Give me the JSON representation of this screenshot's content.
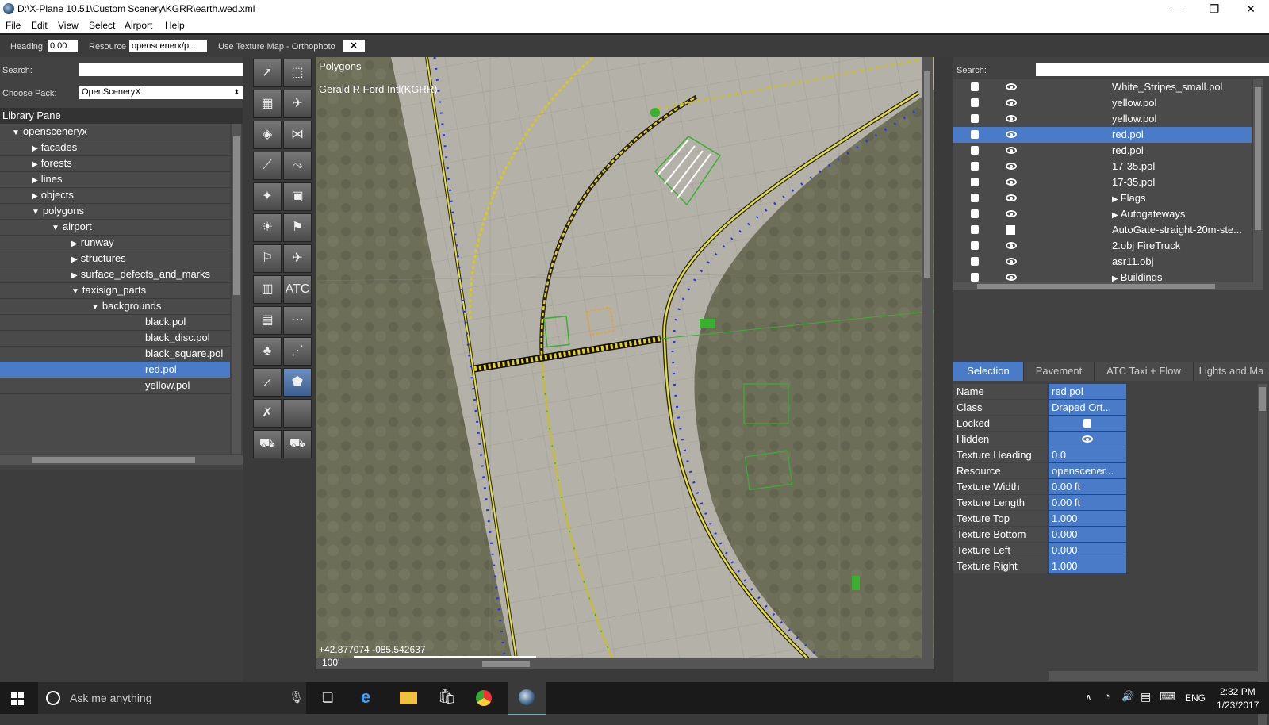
{
  "window": {
    "title": "D:\\X-Plane 10.51\\Custom Scenery\\KGRR\\earth.wed.xml",
    "minimize": "—",
    "maximize": "❐",
    "close": "✕"
  },
  "menu": [
    "File",
    "Edit",
    "View",
    "Select",
    "Airport",
    "Help"
  ],
  "toolbar": {
    "heading_label": "Heading",
    "heading_value": "0.00",
    "resource_label": "Resource",
    "resource_value": "openscenerx/p...",
    "texture_map_label": "Use Texture Map - Orthophoto",
    "close_glyph": "✕"
  },
  "left": {
    "search_label": "Search:",
    "choose_pack_label": "Choose Pack:",
    "choose_pack_value": "OpenSceneryX",
    "library_pane_label": "Library Pane",
    "tree": [
      {
        "label": "opensceneryx",
        "indent": 1,
        "tri": "open"
      },
      {
        "label": "facades",
        "indent": 2,
        "tri": "closed"
      },
      {
        "label": "forests",
        "indent": 2,
        "tri": "closed"
      },
      {
        "label": "lines",
        "indent": 2,
        "tri": "closed"
      },
      {
        "label": "objects",
        "indent": 2,
        "tri": "closed"
      },
      {
        "label": "polygons",
        "indent": 2,
        "tri": "open"
      },
      {
        "label": "airport",
        "indent": 3,
        "tri": "open"
      },
      {
        "label": "runway",
        "indent": 4,
        "tri": "closed"
      },
      {
        "label": "structures",
        "indent": 4,
        "tri": "closed"
      },
      {
        "label": "surface_defects_and_marks",
        "indent": 4,
        "tri": "closed"
      },
      {
        "label": "taxisign_parts",
        "indent": 4,
        "tri": "open"
      },
      {
        "label": "backgrounds",
        "indent": 5,
        "tri": "open"
      },
      {
        "label": "black.pol",
        "indent": 6,
        "tri": "none"
      },
      {
        "label": "black_disc.pol",
        "indent": 6,
        "tri": "none"
      },
      {
        "label": "black_square.pol",
        "indent": 6,
        "tri": "none"
      },
      {
        "label": "red.pol",
        "indent": 6,
        "tri": "none",
        "selected": true
      },
      {
        "label": "yellow.pol",
        "indent": 6,
        "tri": "none"
      }
    ]
  },
  "map": {
    "mode_label": "Polygons",
    "airport_label": "Gerald R Ford Intl(KGRR)",
    "coords": "+42.877074 -085.542637",
    "scale_label": "100'"
  },
  "right": {
    "search_label": "Search:",
    "layers": [
      {
        "name": "White_Stripes_small.pol",
        "vis": "eye",
        "arrow": false
      },
      {
        "name": "yellow.pol",
        "vis": "eye",
        "arrow": false
      },
      {
        "name": "yellow.pol",
        "vis": "eye",
        "arrow": false
      },
      {
        "name": "red.pol",
        "vis": "eye",
        "arrow": false,
        "selected": true
      },
      {
        "name": "red.pol",
        "vis": "eye",
        "arrow": false
      },
      {
        "name": "17-35.pol",
        "vis": "eye",
        "arrow": false
      },
      {
        "name": "17-35.pol",
        "vis": "eye",
        "arrow": false
      },
      {
        "name": "Flags",
        "vis": "eye",
        "arrow": true
      },
      {
        "name": "Autogateways",
        "vis": "eye",
        "arrow": true
      },
      {
        "name": "AutoGate-straight-20m-ste...",
        "vis": "box",
        "arrow": false
      },
      {
        "name": "2.obj FireTruck",
        "vis": "eye",
        "arrow": false
      },
      {
        "name": "asr11.obj",
        "vis": "eye",
        "arrow": false
      },
      {
        "name": "Buildings",
        "vis": "eye",
        "arrow": true
      }
    ],
    "tabs": [
      "Selection",
      "Pavement",
      "ATC Taxi + Flow",
      "Lights and Ma"
    ],
    "properties": [
      {
        "key": "Name",
        "value": "red.pol"
      },
      {
        "key": "Class",
        "value": "Draped Ort..."
      },
      {
        "key": "Locked",
        "value": "",
        "icon": "lock"
      },
      {
        "key": "Hidden",
        "value": "",
        "icon": "eye"
      },
      {
        "key": "Texture Heading",
        "value": " 0.0"
      },
      {
        "key": "Resource",
        "value": "openscener..."
      },
      {
        "key": "Texture Width",
        "value": " 0.00 ft"
      },
      {
        "key": "Texture Length",
        "value": " 0.00 ft"
      },
      {
        "key": "Texture Top",
        "value": "1.000"
      },
      {
        "key": "Texture Bottom",
        "value": "0.000"
      },
      {
        "key": "Texture Left",
        "value": "0.000"
      },
      {
        "key": "Texture Right",
        "value": "1.000"
      }
    ]
  },
  "taskbar": {
    "search_placeholder": "Ask me anything",
    "language": "ENG",
    "time": "2:32 PM",
    "date": "1/23/2017"
  }
}
